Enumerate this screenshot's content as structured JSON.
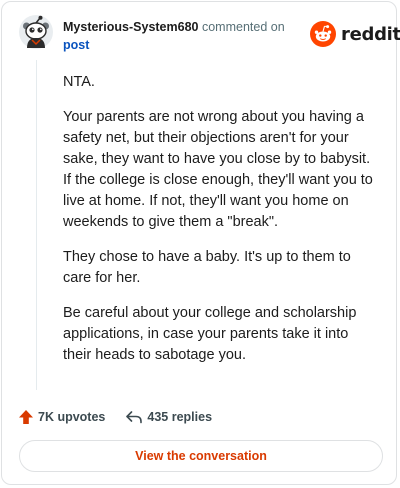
{
  "header": {
    "username": "Mysterious-System680",
    "action_text": "commented on",
    "post_link": "post",
    "brand": "reddit"
  },
  "comment": {
    "paragraphs": [
      "NTA.",
      "Your parents are not wrong about you having a safety net, but their objections aren't for your sake, they want to have you close by to babysit. If the college is close enough, they'll want you to live at home. If not, they'll want you home on weekends to give them a \"break\".",
      "They chose to have a baby. It's up to them to care for her.",
      "Be careful about your college and scholarship applications, in case your parents take it into their heads to sabotage you."
    ]
  },
  "actions": {
    "upvotes": "7K upvotes",
    "replies": "435 replies"
  },
  "cta": {
    "label": "View the conversation"
  },
  "icons": {
    "avatar": "snoo-avatar-icon",
    "brand": "reddit-logo-icon",
    "upvote": "upvote-arrow-icon",
    "reply": "reply-arrow-icon"
  },
  "colors": {
    "brand_orange": "#ff4500",
    "upvote": "#d93a00",
    "link": "#0a53be",
    "cta_text": "#d93a00"
  }
}
